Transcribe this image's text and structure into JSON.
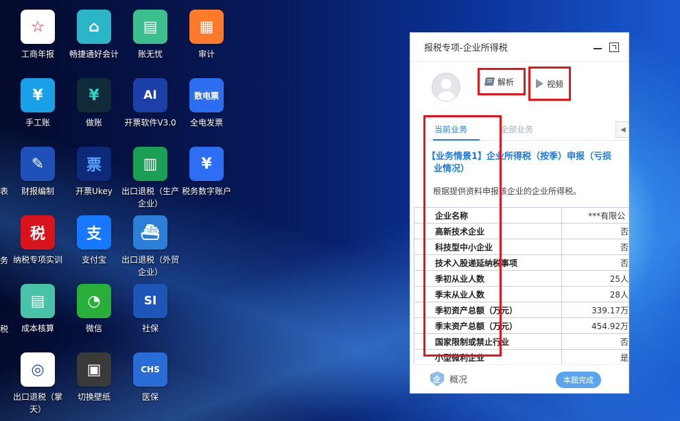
{
  "desktop": {
    "icons": [
      {
        "label": "工商年报",
        "glyph": "☆",
        "bg": "#ffffff",
        "fg": "#d21f1f",
        "icon": "national-emblem-icon"
      },
      {
        "label": "畅捷通好会计",
        "glyph": "⌂",
        "bg": "#2bb5c8",
        "fg": "#ffffff",
        "icon": "cloud-plug-icon"
      },
      {
        "label": "账无忧",
        "glyph": "▤",
        "bg": "#3bbf8f",
        "fg": "#ffffff",
        "icon": "open-book-icon"
      },
      {
        "label": "审计",
        "glyph": "▦",
        "bg": "#ff7a2a",
        "fg": "#ffffff",
        "icon": "audit-ticket-icon"
      },
      {
        "label": "手工账",
        "glyph": "¥",
        "bg": "#1aa0e8",
        "fg": "#ffffff",
        "icon": "ledger-icon"
      },
      {
        "label": "做账",
        "glyph": "¥",
        "bg": "#0f2a38",
        "fg": "#2bd9c9",
        "icon": "shield-yen-icon"
      },
      {
        "label": "开票软件V3.0",
        "glyph": "AI",
        "bg": "#1d3fa8",
        "fg": "#ffffff",
        "icon": "invoice-software-icon"
      },
      {
        "label": "全电发票",
        "glyph": "数电票",
        "bg": "#2d6ef0",
        "fg": "#ffffff",
        "icon": "digital-invoice-icon"
      },
      {
        "label": "财报编制",
        "glyph": "✎",
        "bg": "#1f4fb8",
        "fg": "#ffffff",
        "icon": "report-edit-icon"
      },
      {
        "label": "开票Ukey",
        "glyph": "票",
        "bg": "#0d2a7a",
        "fg": "#59a4ff",
        "icon": "ukey-invoice-icon"
      },
      {
        "label": "出口退税（生产企业）",
        "glyph": "▥",
        "bg": "#1a9f55",
        "fg": "#ffffff",
        "icon": "factory-icon"
      },
      {
        "label": "税务数字账户",
        "glyph": "¥",
        "bg": "#2e6ef5",
        "fg": "#ffffff",
        "icon": "tax-digital-account-icon"
      },
      {
        "label": "纳税专项实训",
        "glyph": "税",
        "bg": "#d8131b",
        "fg": "#ffffff",
        "icon": "tax-training-icon"
      },
      {
        "label": "支付宝",
        "glyph": "支",
        "bg": "#1678ff",
        "fg": "#ffffff",
        "icon": "alipay-icon"
      },
      {
        "label": "出口退税（外贸企业）",
        "glyph": "⛴",
        "bg": "#2b7fd6",
        "fg": "#ffffff",
        "icon": "ship-icon"
      },
      {
        "label": "成本核算",
        "glyph": "▤",
        "bg": "#48c3a8",
        "fg": "#ffffff",
        "icon": "cost-accounting-icon"
      },
      {
        "label": "微信",
        "glyph": "◔",
        "bg": "#2aae3a",
        "fg": "#ffffff",
        "icon": "wechat-icon"
      },
      {
        "label": "社保",
        "glyph": "SI",
        "bg": "#1d56b7",
        "fg": "#ffffff",
        "icon": "social-security-icon"
      },
      {
        "label": "出口退税（掌天）",
        "glyph": "◎",
        "bg": "#ffffff",
        "fg": "#1b4fb0",
        "icon": "export-rebate-icon"
      },
      {
        "label": "切换壁纸",
        "glyph": "▣",
        "bg": "#3a3a3a",
        "fg": "#ffffff",
        "icon": "wallpaper-icon"
      },
      {
        "label": "医保",
        "glyph": "CHS",
        "bg": "#2a6cd6",
        "fg": "#ffffff",
        "icon": "medical-insurance-icon"
      }
    ],
    "edge_labels": [
      "表",
      "务",
      "税"
    ]
  },
  "panel": {
    "title": "报税专项-企业所得税",
    "analysis_label": "解析",
    "video_label": "视频",
    "tabs": {
      "current": "当前业务",
      "all": "全部业务"
    },
    "case_title_line1": "【业务情景1】企业所得税（按季）申报（亏损",
    "case_title_line2": "业情况）",
    "case_desc": "根据提供资料申报该企业的企业所得税。",
    "table": [
      {
        "key": "企业名称",
        "value": "***有限公"
      },
      {
        "key": "高新技术企业",
        "value": "否"
      },
      {
        "key": "科技型中小企业",
        "value": "否"
      },
      {
        "key": "技术入股递延纳税事项",
        "value": "否"
      },
      {
        "key": "季初从业人数",
        "value": "25人"
      },
      {
        "key": "季末从业人数",
        "value": "28人"
      },
      {
        "key": "季初资产总额（万元）",
        "value": "339.17万"
      },
      {
        "key": "季末资产总额（万元）",
        "value": "454.92万"
      },
      {
        "key": "国家限制或禁止行业",
        "value": "否"
      },
      {
        "key": "小型微利企业",
        "value": "是"
      }
    ],
    "footer": {
      "overview_label": "概况",
      "overview_glyph": "企",
      "complete_label": "本题完成"
    }
  },
  "colors": {
    "accent": "#1f7ae0",
    "highlight": "#e8141a",
    "complete_btn": "#5aa5ee"
  }
}
